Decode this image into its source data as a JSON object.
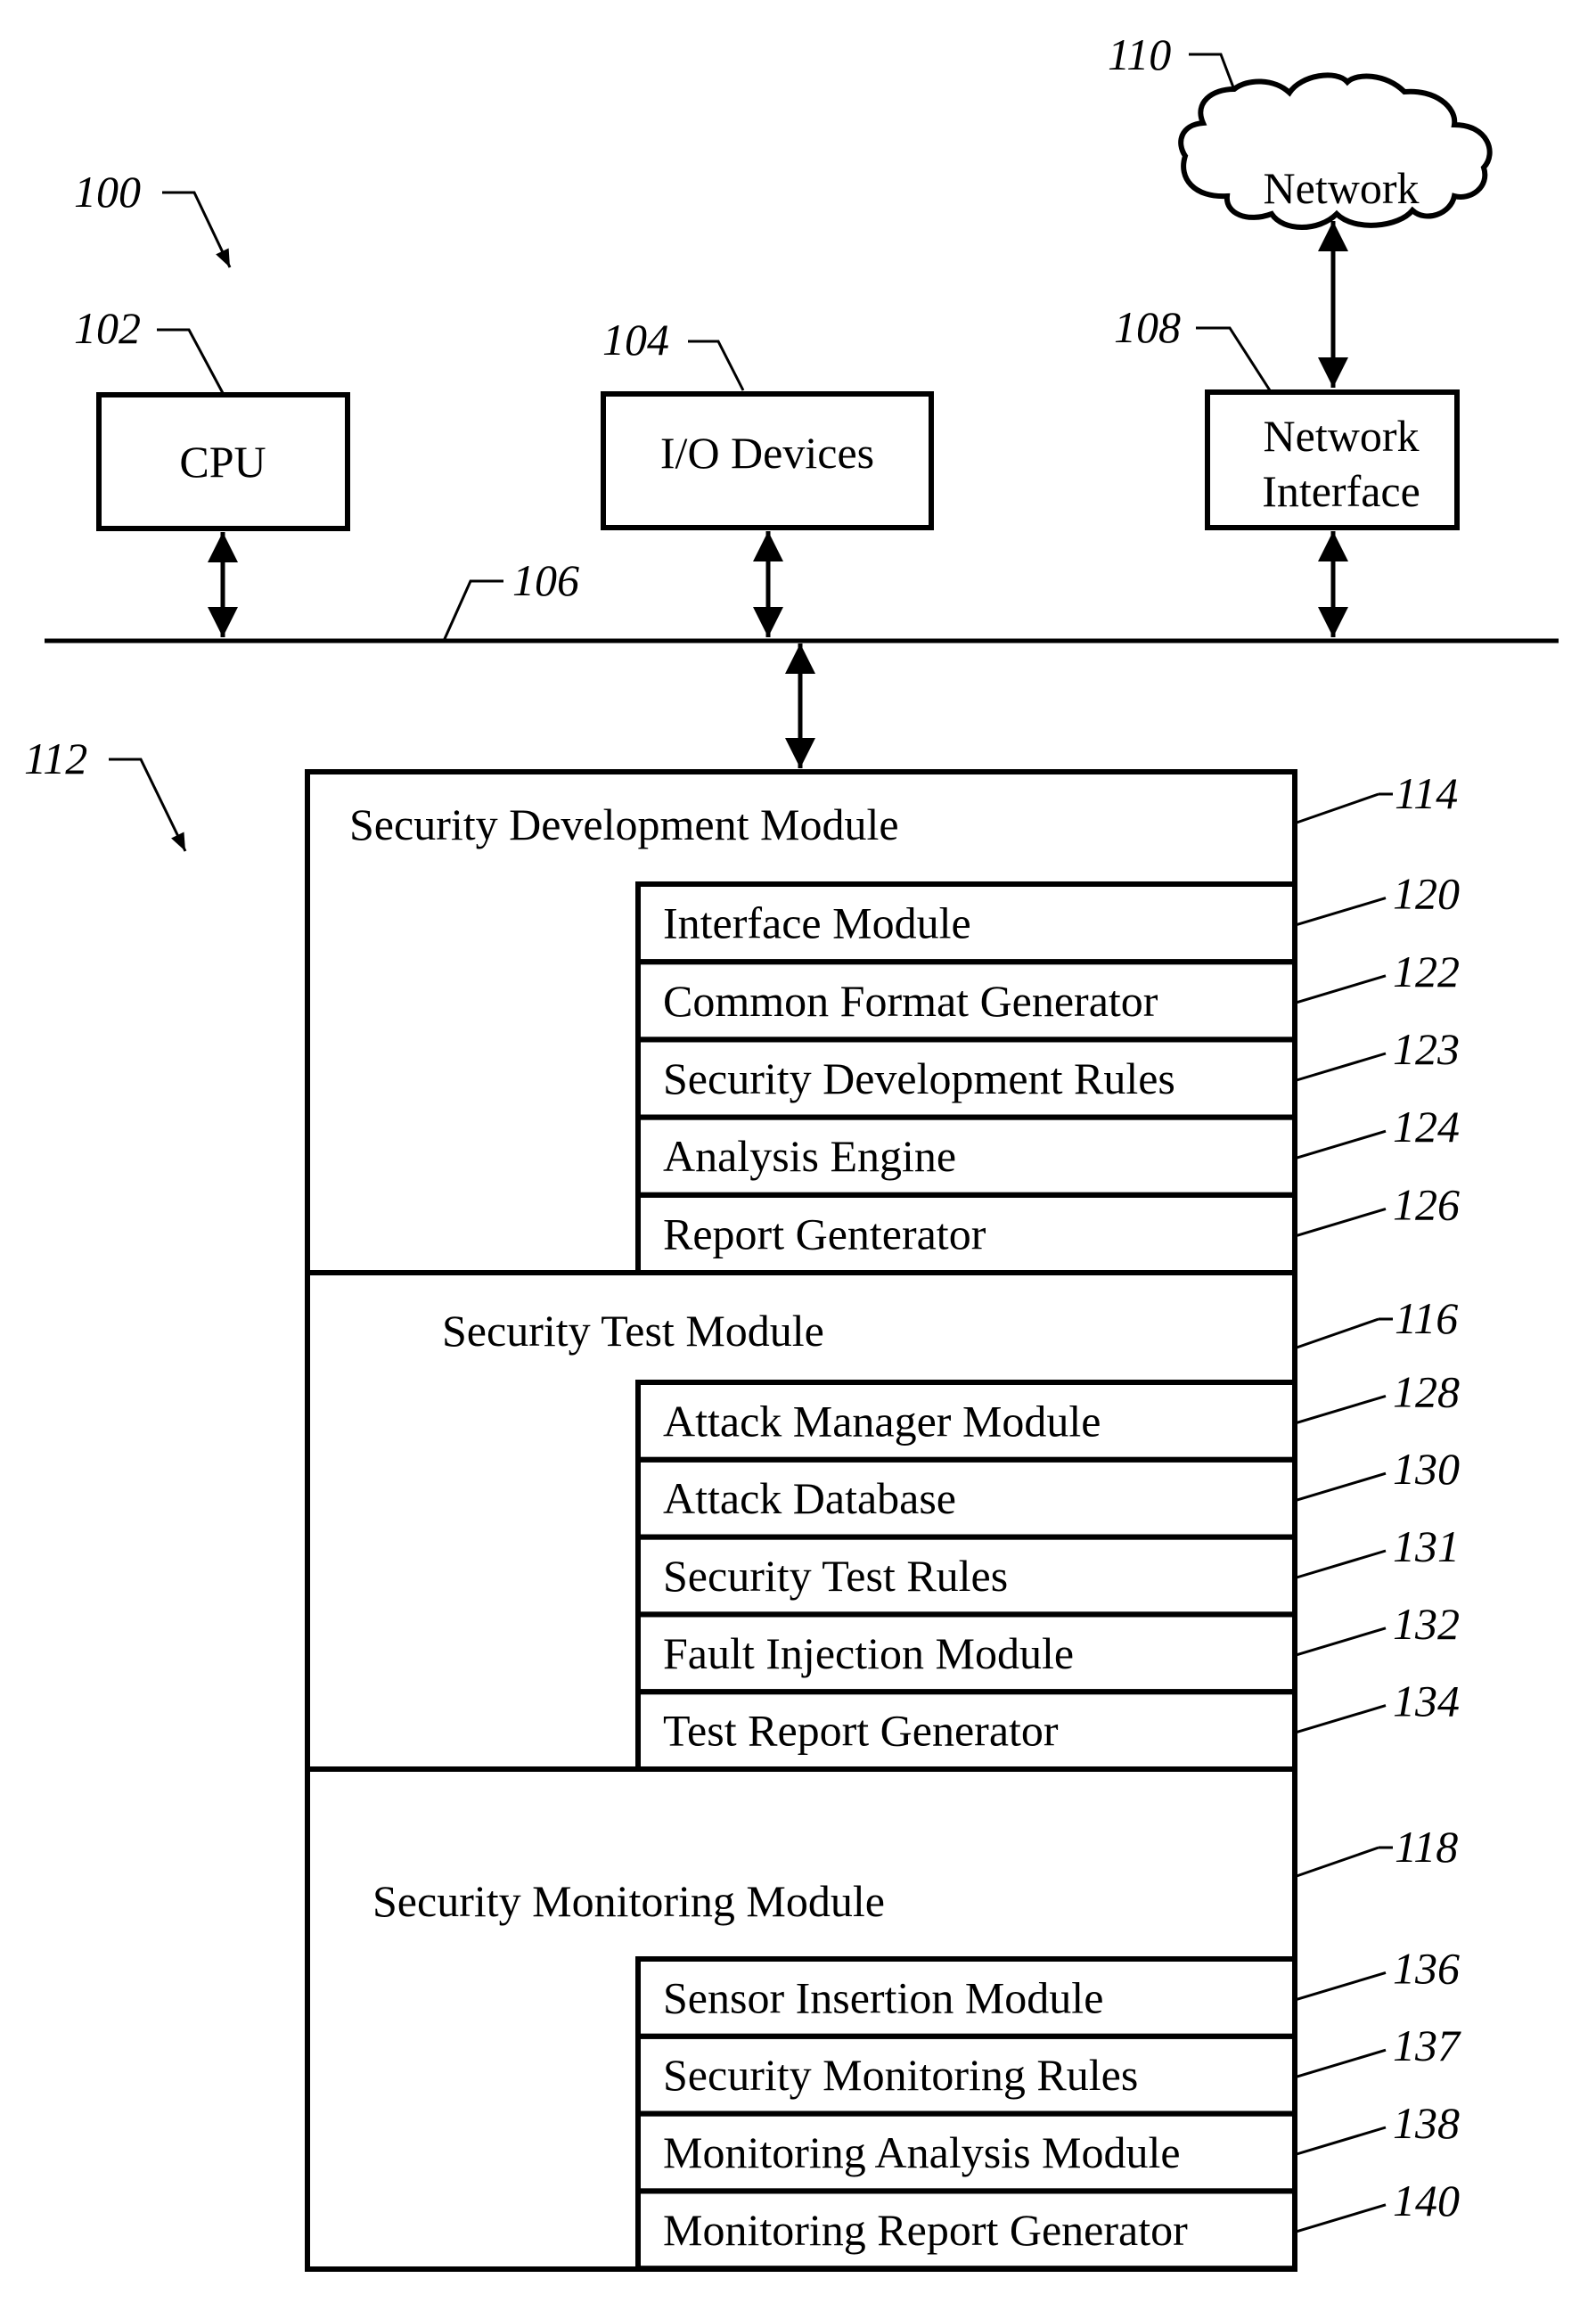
{
  "figure": {
    "system_ref": "100",
    "memory_ref": "112",
    "bus_ref": "106"
  },
  "top_components": [
    {
      "id": "cpu",
      "ref": "102",
      "lines": [
        "CPU"
      ]
    },
    {
      "id": "io",
      "ref": "104",
      "lines": [
        "I/O Devices"
      ]
    },
    {
      "id": "netif",
      "ref": "108",
      "lines": [
        "Network",
        "Interface"
      ]
    }
  ],
  "network": {
    "ref": "110",
    "label": "Network"
  },
  "modules": [
    {
      "ref": "114",
      "title": "Security Development Module",
      "submodules": [
        {
          "ref": "120",
          "label": "Interface Module"
        },
        {
          "ref": "122",
          "label": "Common Format Generator"
        },
        {
          "ref": "123",
          "label": "Security Development Rules"
        },
        {
          "ref": "124",
          "label": "Analysis Engine"
        },
        {
          "ref": "126",
          "label": "Report Genterator"
        }
      ]
    },
    {
      "ref": "116",
      "title": "Security Test Module",
      "submodules": [
        {
          "ref": "128",
          "label": "Attack Manager Module"
        },
        {
          "ref": "130",
          "label": "Attack Database"
        },
        {
          "ref": "131",
          "label": "Security Test Rules"
        },
        {
          "ref": "132",
          "label": "Fault Injection Module"
        },
        {
          "ref": "134",
          "label": "Test Report Generator"
        }
      ]
    },
    {
      "ref": "118",
      "title": "Security Monitoring Module",
      "submodules": [
        {
          "ref": "136",
          "label": "Sensor Insertion Module"
        },
        {
          "ref": "137",
          "label": "Security Monitoring Rules"
        },
        {
          "ref": "138",
          "label": "Monitoring Analysis Module"
        },
        {
          "ref": "140",
          "label": "Monitoring Report Generator"
        }
      ]
    }
  ]
}
